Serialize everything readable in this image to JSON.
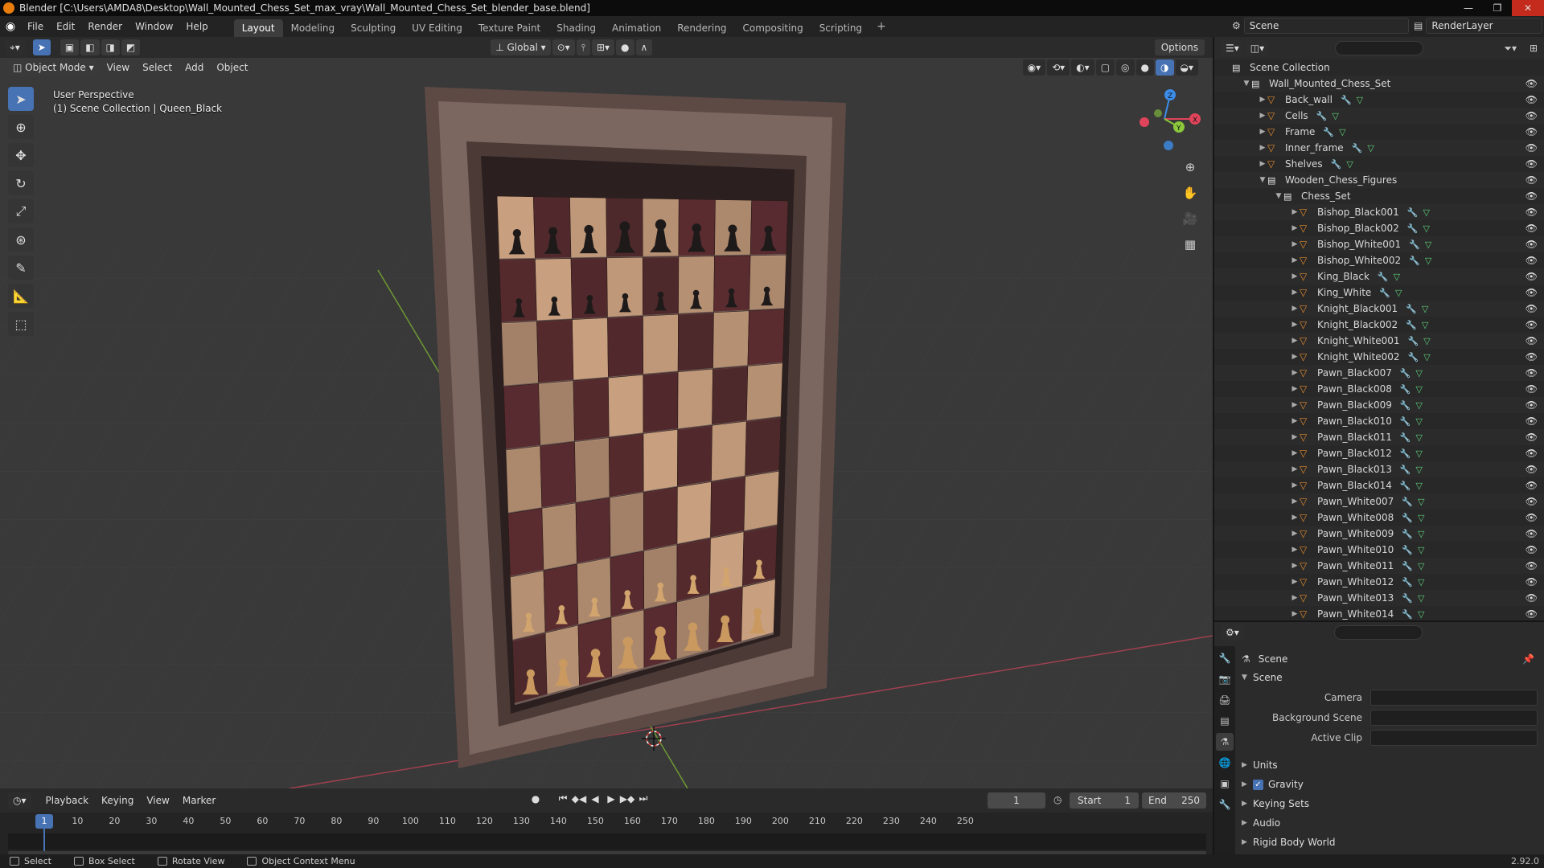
{
  "window": {
    "title": "Blender [C:\\Users\\AMDA8\\Desktop\\Wall_Mounted_Chess_Set_max_vray\\Wall_Mounted_Chess_Set_blender_base.blend]",
    "minimize": "—",
    "maximize": "❐",
    "close": "✕"
  },
  "menus": [
    "File",
    "Edit",
    "Render",
    "Window",
    "Help"
  ],
  "workspaces": [
    "Layout",
    "Modeling",
    "Sculpting",
    "UV Editing",
    "Texture Paint",
    "Shading",
    "Animation",
    "Rendering",
    "Compositing",
    "Scripting"
  ],
  "active_workspace": "Layout",
  "scene_name": "Scene",
  "render_layer": "RenderLayer",
  "viewport": {
    "orientation": "Global",
    "options": "Options",
    "mode": "Object Mode",
    "menu": [
      "View",
      "Select",
      "Add",
      "Object"
    ],
    "perspective": "User Perspective",
    "context": "(1) Scene Collection | Queen_Black"
  },
  "outliner": {
    "root": "Scene Collection",
    "rows": [
      {
        "name": "Wall_Mounted_Chess_Set",
        "type": "coll",
        "depth": 1,
        "open": true
      },
      {
        "name": "Back_wall",
        "type": "mesh",
        "depth": 2
      },
      {
        "name": "Cells",
        "type": "mesh",
        "depth": 2
      },
      {
        "name": "Frame",
        "type": "mesh",
        "depth": 2
      },
      {
        "name": "Inner_frame",
        "type": "mesh",
        "depth": 2
      },
      {
        "name": "Shelves",
        "type": "mesh",
        "depth": 2
      },
      {
        "name": "Wooden_Chess_Figures",
        "type": "coll",
        "depth": 2,
        "open": true
      },
      {
        "name": "Chess_Set",
        "type": "coll",
        "depth": 3,
        "open": true
      },
      {
        "name": "Bishop_Black001",
        "type": "mesh",
        "depth": 4
      },
      {
        "name": "Bishop_Black002",
        "type": "mesh",
        "depth": 4
      },
      {
        "name": "Bishop_White001",
        "type": "mesh",
        "depth": 4
      },
      {
        "name": "Bishop_White002",
        "type": "mesh",
        "depth": 4
      },
      {
        "name": "King_Black",
        "type": "mesh",
        "depth": 4
      },
      {
        "name": "King_White",
        "type": "mesh",
        "depth": 4
      },
      {
        "name": "Knight_Black001",
        "type": "mesh",
        "depth": 4
      },
      {
        "name": "Knight_Black002",
        "type": "mesh",
        "depth": 4
      },
      {
        "name": "Knight_White001",
        "type": "mesh",
        "depth": 4
      },
      {
        "name": "Knight_White002",
        "type": "mesh",
        "depth": 4
      },
      {
        "name": "Pawn_Black007",
        "type": "mesh",
        "depth": 4
      },
      {
        "name": "Pawn_Black008",
        "type": "mesh",
        "depth": 4
      },
      {
        "name": "Pawn_Black009",
        "type": "mesh",
        "depth": 4
      },
      {
        "name": "Pawn_Black010",
        "type": "mesh",
        "depth": 4
      },
      {
        "name": "Pawn_Black011",
        "type": "mesh",
        "depth": 4
      },
      {
        "name": "Pawn_Black012",
        "type": "mesh",
        "depth": 4
      },
      {
        "name": "Pawn_Black013",
        "type": "mesh",
        "depth": 4
      },
      {
        "name": "Pawn_Black014",
        "type": "mesh",
        "depth": 4
      },
      {
        "name": "Pawn_White007",
        "type": "mesh",
        "depth": 4
      },
      {
        "name": "Pawn_White008",
        "type": "mesh",
        "depth": 4
      },
      {
        "name": "Pawn_White009",
        "type": "mesh",
        "depth": 4
      },
      {
        "name": "Pawn_White010",
        "type": "mesh",
        "depth": 4
      },
      {
        "name": "Pawn_White011",
        "type": "mesh",
        "depth": 4
      },
      {
        "name": "Pawn_White012",
        "type": "mesh",
        "depth": 4
      },
      {
        "name": "Pawn_White013",
        "type": "mesh",
        "depth": 4
      },
      {
        "name": "Pawn_White014",
        "type": "mesh",
        "depth": 4
      }
    ]
  },
  "properties": {
    "header": "Scene",
    "panel": "Scene",
    "fields": [
      "Camera",
      "Background Scene",
      "Active Clip"
    ],
    "subpanels": [
      "Units",
      "Gravity",
      "Keying Sets",
      "Audio",
      "Rigid Body World"
    ],
    "gravity_checked": true
  },
  "timeline": {
    "menus": [
      "Playback",
      "Keying",
      "View",
      "Marker"
    ],
    "current_frame": "1",
    "start_label": "Start",
    "start": "1",
    "end_label": "End",
    "end": "250",
    "ticks": [
      "10",
      "20",
      "30",
      "40",
      "50",
      "60",
      "70",
      "80",
      "90",
      "100",
      "110",
      "120",
      "130",
      "140",
      "150",
      "160",
      "170",
      "180",
      "190",
      "200",
      "210",
      "220",
      "230",
      "240",
      "250"
    ]
  },
  "status": {
    "items": [
      "Select",
      "Box Select",
      "Rotate View",
      "Object Context Menu"
    ],
    "version": "2.92.0"
  },
  "colors": {
    "accent": "#4772b3",
    "axis_x": "#e0445a",
    "axis_y": "#8bc83c",
    "axis_z": "#3c8de8",
    "frame_wood": "#6b554e",
    "light_cell": "#c9a07f",
    "dark_cell": "#5a2c30"
  }
}
